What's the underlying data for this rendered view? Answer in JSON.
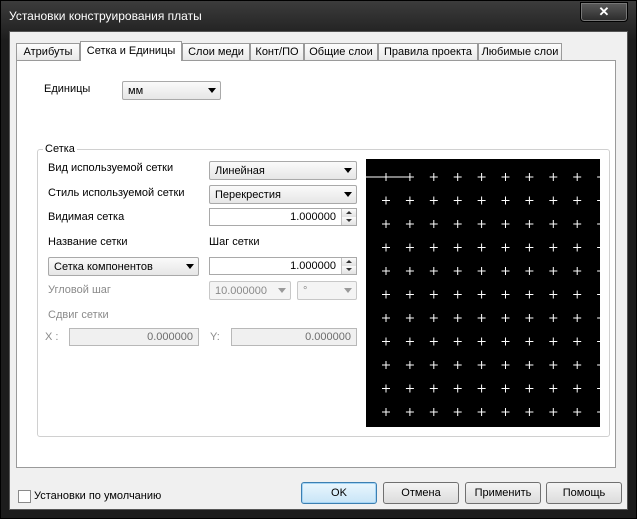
{
  "window": {
    "title": "Установки конструирования платы",
    "close_glyph": "✕"
  },
  "tabs": [
    {
      "label": "Атрибуты"
    },
    {
      "label": "Сетка и Единицы",
      "active": true
    },
    {
      "label": "Слои меди"
    },
    {
      "label": "Конт/ПО"
    },
    {
      "label": "Общие слои"
    },
    {
      "label": "Правила проекта"
    },
    {
      "label": "Любимые слои"
    }
  ],
  "units": {
    "label": "Единицы",
    "value": "мм"
  },
  "grid": {
    "group_title": "Сетка",
    "type": {
      "label": "Вид используемой сетки",
      "value": "Линейная"
    },
    "style": {
      "label": "Стиль используемой сетки",
      "value": "Перекрестия"
    },
    "visible": {
      "label": "Видимая сетка",
      "value": "1.000000"
    },
    "name": {
      "label": "Название сетки",
      "value": "Сетка компонентов"
    },
    "step": {
      "label": "Шаг сетки",
      "value": "1.000000"
    },
    "angle": {
      "label": "Угловой шаг",
      "value": "10.000000",
      "unit": "°"
    },
    "offset": {
      "label": "Сдвиг сетки",
      "x_label": "X :",
      "x_value": "0.000000",
      "y_label": "Y:",
      "y_value": "0.000000"
    }
  },
  "preview": {
    "background": "#000000",
    "mark_color": "#ffffff",
    "columns": 10,
    "rows": 12
  },
  "footer": {
    "default_checkbox_label": "Установки по умолчанию",
    "ok": "OK",
    "cancel": "Отмена",
    "apply": "Применить",
    "help": "Помощь"
  }
}
